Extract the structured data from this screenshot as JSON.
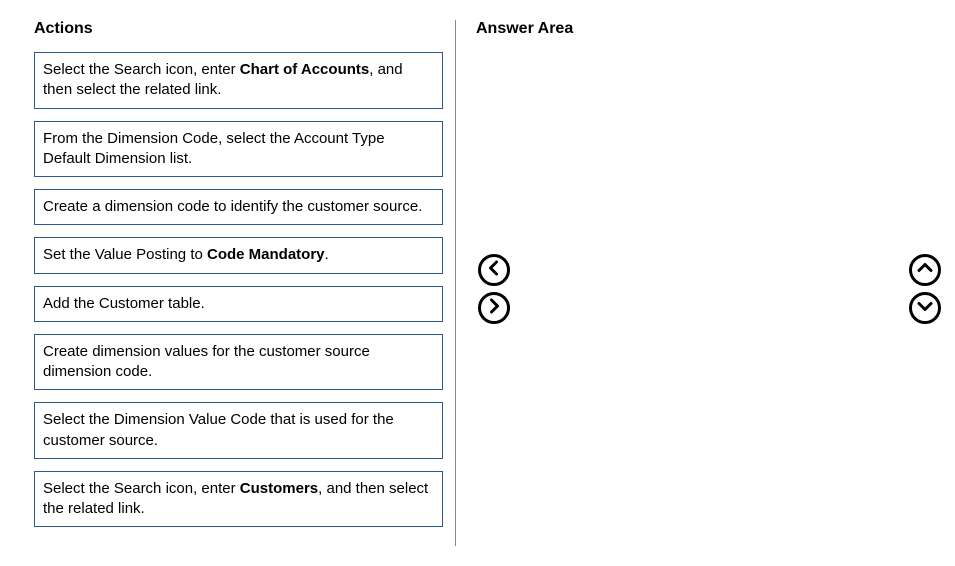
{
  "headings": {
    "actions": "Actions",
    "answer_area": "Answer Area"
  },
  "actions": [
    {
      "pre": "Select the Search icon, enter ",
      "bold": "Chart of Accounts",
      "post": ", and then select the related link."
    },
    {
      "pre": "From the Dimension Code, select the Account Type Default Dimension list.",
      "bold": "",
      "post": ""
    },
    {
      "pre": "Create a dimension code to identify the customer source.",
      "bold": "",
      "post": ""
    },
    {
      "pre": "Set the Value Posting to ",
      "bold": "Code Mandatory",
      "post": "."
    },
    {
      "pre": "Add the Customer table.",
      "bold": "",
      "post": ""
    },
    {
      "pre": "Create dimension values for the customer source dimension code.",
      "bold": "",
      "post": ""
    },
    {
      "pre": "Select the Dimension Value Code that is used for the customer source.",
      "bold": "",
      "post": ""
    },
    {
      "pre": "Select the Search icon, enter ",
      "bold": "Customers",
      "post": ", and then select the related link."
    }
  ]
}
